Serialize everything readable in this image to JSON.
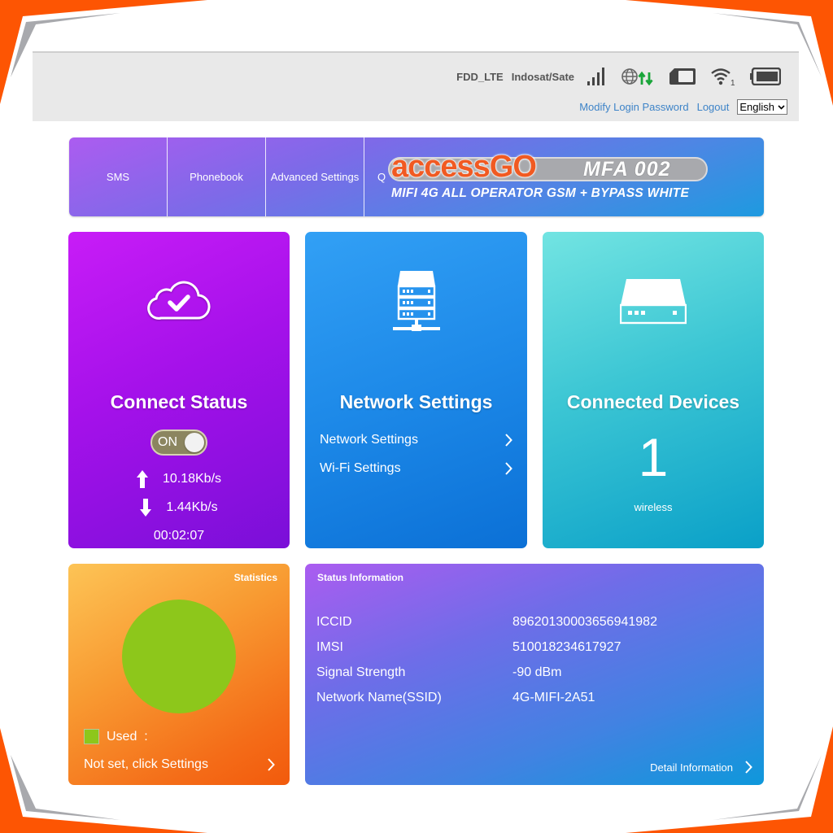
{
  "header": {
    "network_type": "FDD_LTE",
    "operator": "Indosat/Sate",
    "icons": {
      "signal": "signal-bars-icon",
      "data": "globe-data-transfer-icon",
      "sim": "sim-card-icon",
      "wifi": "wifi-icon",
      "battery": "battery-icon"
    },
    "wifi_clients": "1",
    "modify_password_label": "Modify Login Password",
    "logout_label": "Logout",
    "language_selected": "English",
    "link_color": "#3e84c8",
    "data_arrow_color": "#1aa53a"
  },
  "nav": {
    "items": [
      {
        "label": "SMS"
      },
      {
        "label": "Phonebook"
      },
      {
        "label": "Advanced Settings"
      },
      {
        "label": "Q"
      }
    ],
    "brand": {
      "name": "accessGO",
      "model": "MFA 002",
      "subtitle": "MIFI 4G ALL OPERATOR GSM + BYPASS WHITE"
    }
  },
  "connect_status": {
    "title": "Connect Status",
    "toggle_label": "ON",
    "toggle_state": "on",
    "upload_speed": "10.18Kb/s",
    "download_speed": "1.44Kb/s",
    "duration": "00:02:07",
    "icon": "cloud-check-icon"
  },
  "network_settings": {
    "title": "Network Settings",
    "icon": "server-network-icon",
    "links": [
      {
        "label": "Network Settings"
      },
      {
        "label": "Wi-Fi Settings"
      }
    ]
  },
  "connected_devices": {
    "title": "Connected Devices",
    "icon": "router-device-icon",
    "count": "1",
    "type_label": "wireless"
  },
  "statistics": {
    "title": "Statistics",
    "used_label": "Used  :",
    "used_color": "#8dc71b",
    "used_fraction": 1.0,
    "settings_link": "Not set, click Settings"
  },
  "status_information": {
    "title": "Status Information",
    "rows": [
      {
        "key": "ICCID",
        "value": "89620130003656941982"
      },
      {
        "key": "IMSI",
        "value": "510018234617927"
      },
      {
        "key": "Signal Strength",
        "value": "-90 dBm"
      },
      {
        "key": "Network Name(SSID)",
        "value": "4G-MIFI-2A51"
      }
    ],
    "detail_link": "Detail Information"
  },
  "theme": {
    "frame_orange": "#fd5503",
    "frame_gray": "#a8a9ad"
  }
}
